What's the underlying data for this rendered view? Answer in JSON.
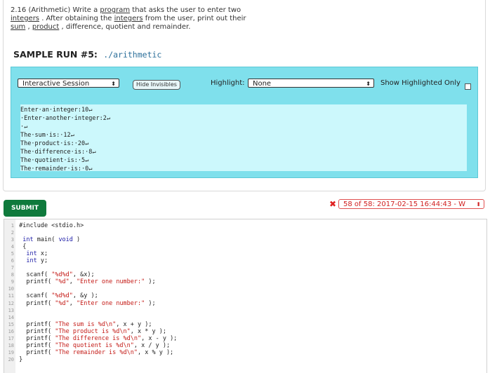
{
  "prompt": {
    "prefix": "2.16 (Arithmetic) Write a ",
    "link_program": "program",
    "mid1": "  that asks the user to enter two",
    "link_integers1": "integers",
    "mid2": " . After obtaining the ",
    "link_integers2": "integers",
    "mid3": "  from the user, print out their",
    "link_sum": "sum",
    "mid4": " , ",
    "link_product": "product",
    "suffix": " , difference, quotient and remainder."
  },
  "sample_run": {
    "title": "SAMPLE RUN #5:",
    "command": "./arithmetic"
  },
  "toolbar": {
    "session_select": "Interactive Session",
    "hide_invisibles": "Hide Invisibles",
    "highlight_label": "Highlight:",
    "highlight_select": "None",
    "show_highlighted_only": "Show Highlighted Only"
  },
  "terminal": [
    "Enter·an·integer:10↵",
    "·Enter·another·integer:2↵",
    "·↵",
    "The·sum·is:·12↵",
    "The·product·is:·20↵",
    "The·difference·is:·8↵",
    "The·quotient·is:·5↵",
    "The·remainder·is:·0↵"
  ],
  "submit_label": "SUBMIT",
  "history_select": "58 of 58: 2017-02-15 16:44:43 - W",
  "code_lines": [
    "#include <stdio.h>",
    "",
    " int main( void )",
    " {",
    "  int x;",
    "  int y;",
    "",
    "  scanf( \"%d%d\", &x);",
    "  printf( \"%d\", \"Enter one number:\" );",
    "",
    "  scanf( \"%d%d\", &y );",
    "  printf( \"%d\", \"Enter one number:\" );",
    "",
    "",
    "  printf( \"The sum is %d\\n\", x + y );",
    "  printf( \"The product is %d\\n\", x * y );",
    "  printf( \"The difference is %d\\n\", x - y );",
    "  printf( \"The quotient is %d\\n\", x / y );",
    "  printf( \"The remainder is %d\\n\", x % y );",
    "}"
  ],
  "line_numbers": [
    "1",
    "2",
    "3",
    "4",
    "5",
    "6",
    "7",
    "8",
    "9",
    "10",
    "11",
    "12",
    "13",
    "14",
    "15",
    "16",
    "17",
    "18",
    "19",
    "20"
  ],
  "colors": {
    "accent_green": "#0f7a3c",
    "terminal_bg": "#ccf8fc",
    "panel_bg": "#7fe0ec",
    "error_red": "#e02020"
  },
  "icons": {
    "select_arrows": "updown-arrows-icon",
    "error": "x-icon"
  }
}
